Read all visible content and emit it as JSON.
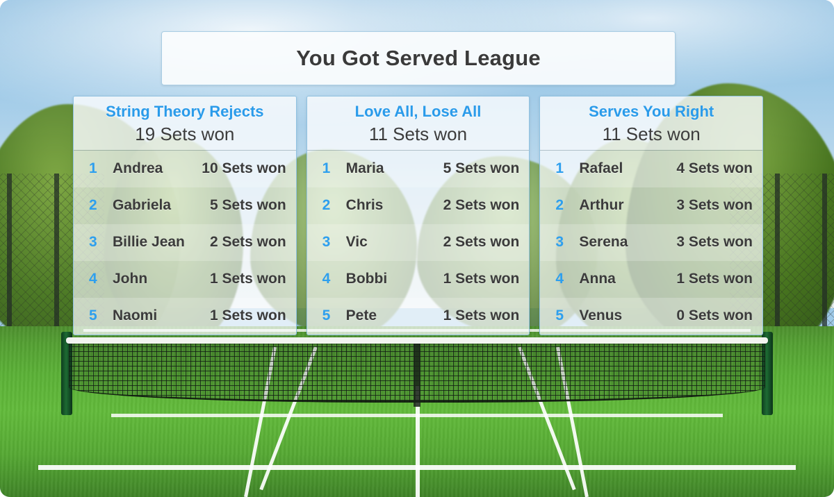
{
  "header": {
    "title": "You Got Served League"
  },
  "theme": {
    "accent_blue": "#2a9bea",
    "rank_blue": "#2e9fee",
    "text_dark": "#3b3b3b",
    "panel_border": "#8fc2e2",
    "court_green": "#5bb137"
  },
  "score_unit": "Sets won",
  "boards": [
    {
      "name": "String Theory Rejects",
      "total": "19 Sets won",
      "players": [
        {
          "rank": "1",
          "name": "Andrea",
          "score": "10 Sets won"
        },
        {
          "rank": "2",
          "name": "Gabriela",
          "score": "5 Sets won"
        },
        {
          "rank": "3",
          "name": "Billie Jean",
          "score": "2 Sets won"
        },
        {
          "rank": "4",
          "name": "John",
          "score": "1 Sets won"
        },
        {
          "rank": "5",
          "name": "Naomi",
          "score": "1 Sets won"
        }
      ]
    },
    {
      "name": "Love All, Lose All",
      "total": "11 Sets won",
      "players": [
        {
          "rank": "1",
          "name": "Maria",
          "score": "5 Sets won"
        },
        {
          "rank": "2",
          "name": "Chris",
          "score": "2 Sets won"
        },
        {
          "rank": "3",
          "name": "Vic",
          "score": "2 Sets won"
        },
        {
          "rank": "4",
          "name": "Bobbi",
          "score": "1 Sets won"
        },
        {
          "rank": "5",
          "name": "Pete",
          "score": "1 Sets won"
        }
      ]
    },
    {
      "name": "Serves You Right",
      "total": "11 Sets won",
      "players": [
        {
          "rank": "1",
          "name": "Rafael",
          "score": "4 Sets won"
        },
        {
          "rank": "2",
          "name": "Arthur",
          "score": "3 Sets won"
        },
        {
          "rank": "3",
          "name": "Serena",
          "score": "3 Sets won"
        },
        {
          "rank": "4",
          "name": "Anna",
          "score": "1 Sets won"
        },
        {
          "rank": "5",
          "name": "Venus",
          "score": "0 Sets won"
        }
      ]
    }
  ]
}
